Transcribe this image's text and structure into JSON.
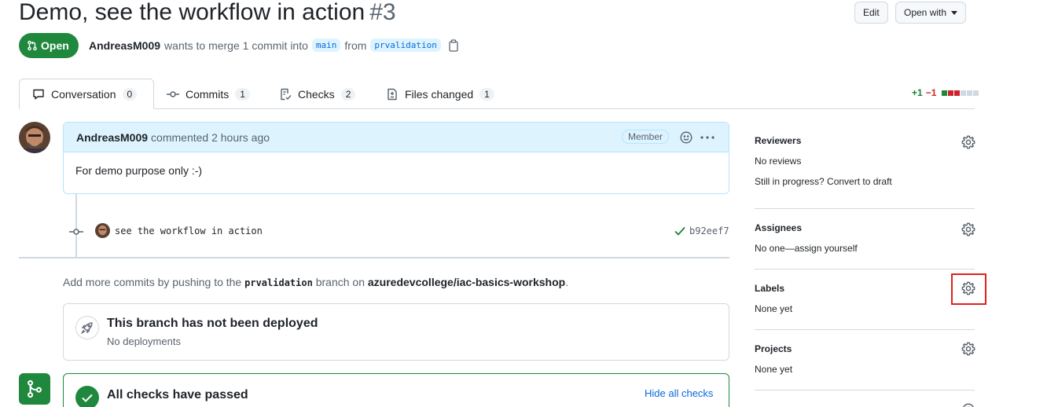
{
  "header": {
    "title": "Demo, see the workflow in action",
    "number": "#3",
    "edit_label": "Edit",
    "open_with_label": "Open with",
    "state_label": "Open",
    "author": "AndreasM009",
    "meta_text": "wants to merge 1 commit into",
    "base_branch": "main",
    "from_text": "from",
    "head_branch": "prvalidation"
  },
  "tabs": [
    {
      "label": "Conversation",
      "count": "0",
      "icon": "comment-icon"
    },
    {
      "label": "Commits",
      "count": "1",
      "icon": "commit-icon"
    },
    {
      "label": "Checks",
      "count": "2",
      "icon": "checklist-icon"
    },
    {
      "label": "Files changed",
      "count": "1",
      "icon": "file-diff-icon"
    }
  ],
  "diffstat": {
    "additions": "+1",
    "deletions": "−1",
    "colors": [
      "#1f883d",
      "#cf222e",
      "#cf222e",
      "#d1d9e0",
      "#d1d9e0",
      "#d1d9e0"
    ]
  },
  "comment": {
    "author": "AndreasM009",
    "time": "commented 2 hours ago",
    "badge": "Member",
    "body": "For demo purpose only :-)"
  },
  "commit": {
    "message": "see the workflow in action",
    "sha": "b92eef7"
  },
  "push_note": {
    "prefix": "Add more commits by pushing to the",
    "branch": "prvalidation",
    "middle": "branch on",
    "repo": "azuredevcollege/iac-basics-workshop",
    "suffix": "."
  },
  "deploy": {
    "title": "This branch has not been deployed",
    "subtitle": "No deployments"
  },
  "checks": {
    "title": "All checks have passed",
    "toggle": "Hide all checks"
  },
  "sidebar": {
    "reviewers": {
      "heading": "Reviewers",
      "line1": "No reviews",
      "line2": "Still in progress? Convert to draft"
    },
    "assignees": {
      "heading": "Assignees",
      "line1": "No one—assign yourself"
    },
    "labels": {
      "heading": "Labels",
      "line1": "None yet"
    },
    "projects": {
      "heading": "Projects",
      "line1": "None yet"
    }
  },
  "colors": {
    "accent": "#0969da",
    "success": "#1f883d",
    "highlight": "#e02020"
  }
}
